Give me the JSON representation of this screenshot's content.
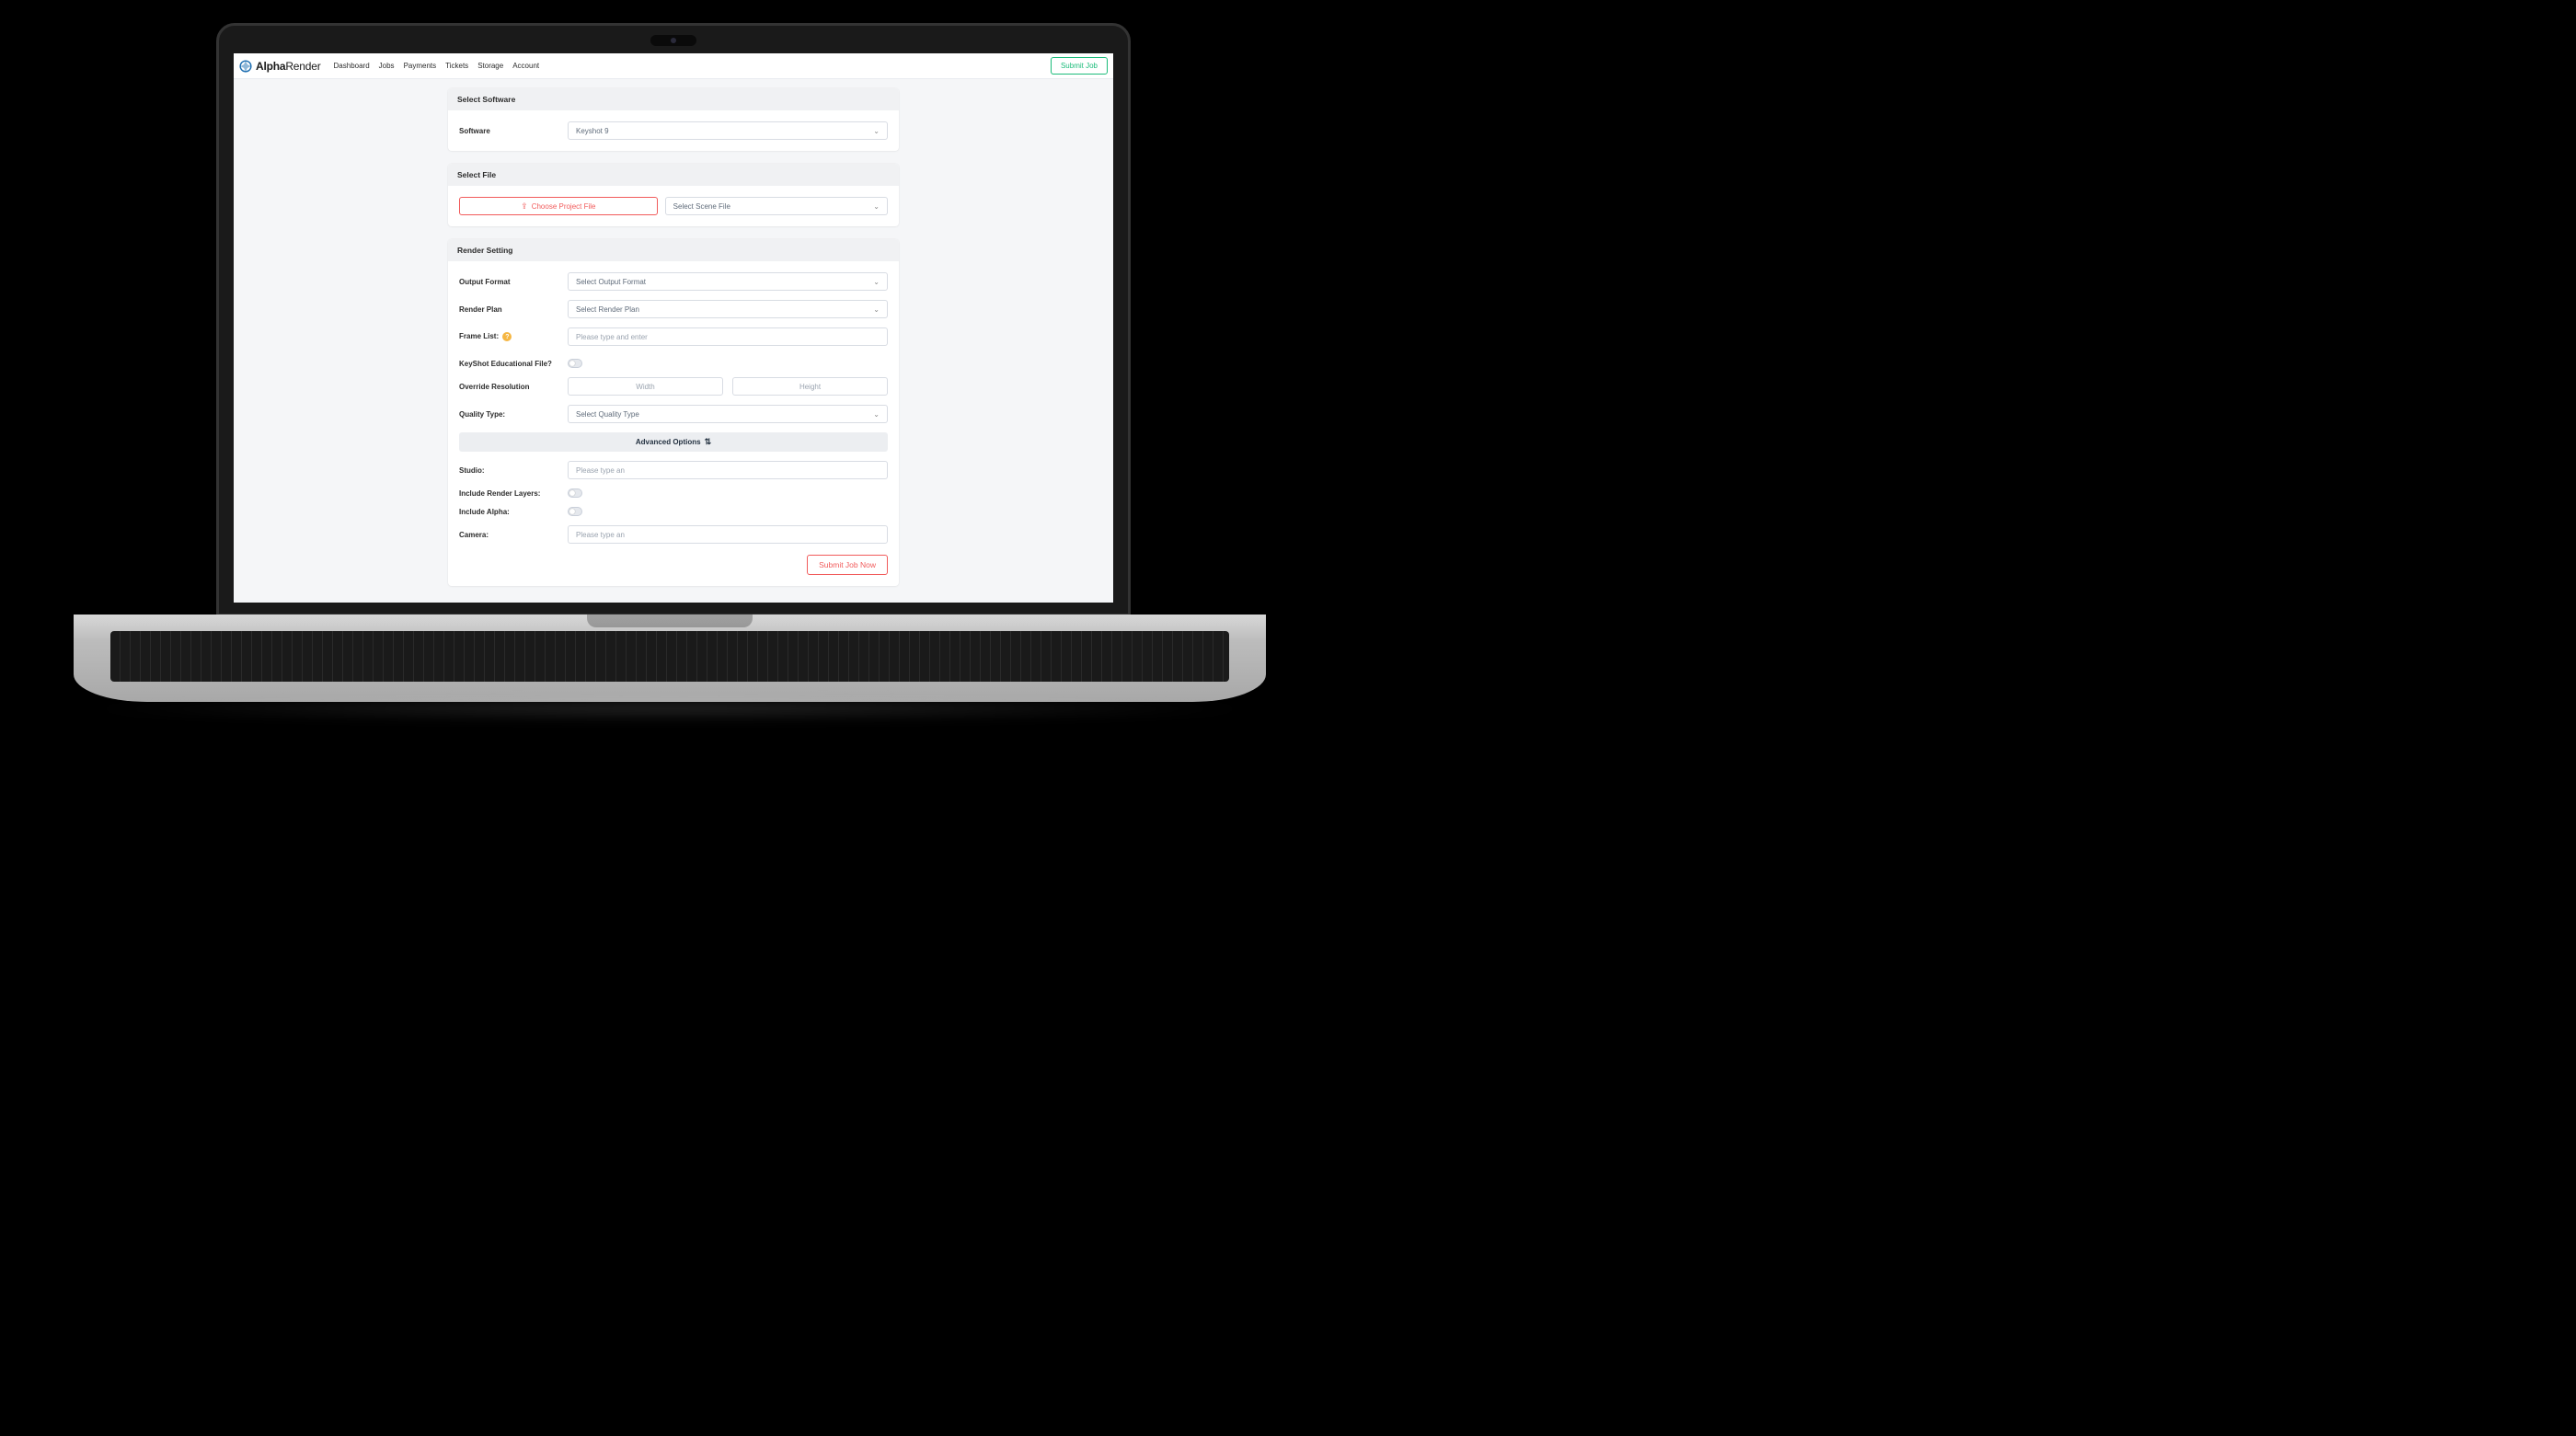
{
  "brand": {
    "primary": "Alpha",
    "secondary": "Render"
  },
  "nav": {
    "items": [
      "Dashboard",
      "Jobs",
      "Payments",
      "Tickets",
      "Storage",
      "Account"
    ],
    "submit": "Submit Job"
  },
  "sections": {
    "software": {
      "title": "Select Software",
      "label": "Software",
      "value": "Keyshot 9"
    },
    "file": {
      "title": "Select File",
      "choose_label": "Choose Project File",
      "scene_placeholder": "Select Scene File"
    },
    "render": {
      "title": "Render Setting",
      "output_format": {
        "label": "Output Format",
        "placeholder": "Select Output Format"
      },
      "render_plan": {
        "label": "Render Plan",
        "placeholder": "Select Render Plan"
      },
      "frame_list": {
        "label": "Frame List:",
        "placeholder": "Please type and enter"
      },
      "edu_file": {
        "label": "KeyShot Educational File?"
      },
      "override_res": {
        "label": "Override Resolution",
        "width_placeholder": "Width",
        "height_placeholder": "Height"
      },
      "quality_type": {
        "label": "Quality Type:",
        "placeholder": "Select Quality Type"
      },
      "advanced_label": "Advanced Options",
      "studio": {
        "label": "Studio:",
        "placeholder": "Please type an"
      },
      "include_layers": {
        "label": "Include Render Layers:"
      },
      "include_alpha": {
        "label": "Include Alpha:"
      },
      "camera": {
        "label": "Camera:",
        "placeholder": "Please type an"
      }
    },
    "submit_now": "Submit Job Now"
  }
}
